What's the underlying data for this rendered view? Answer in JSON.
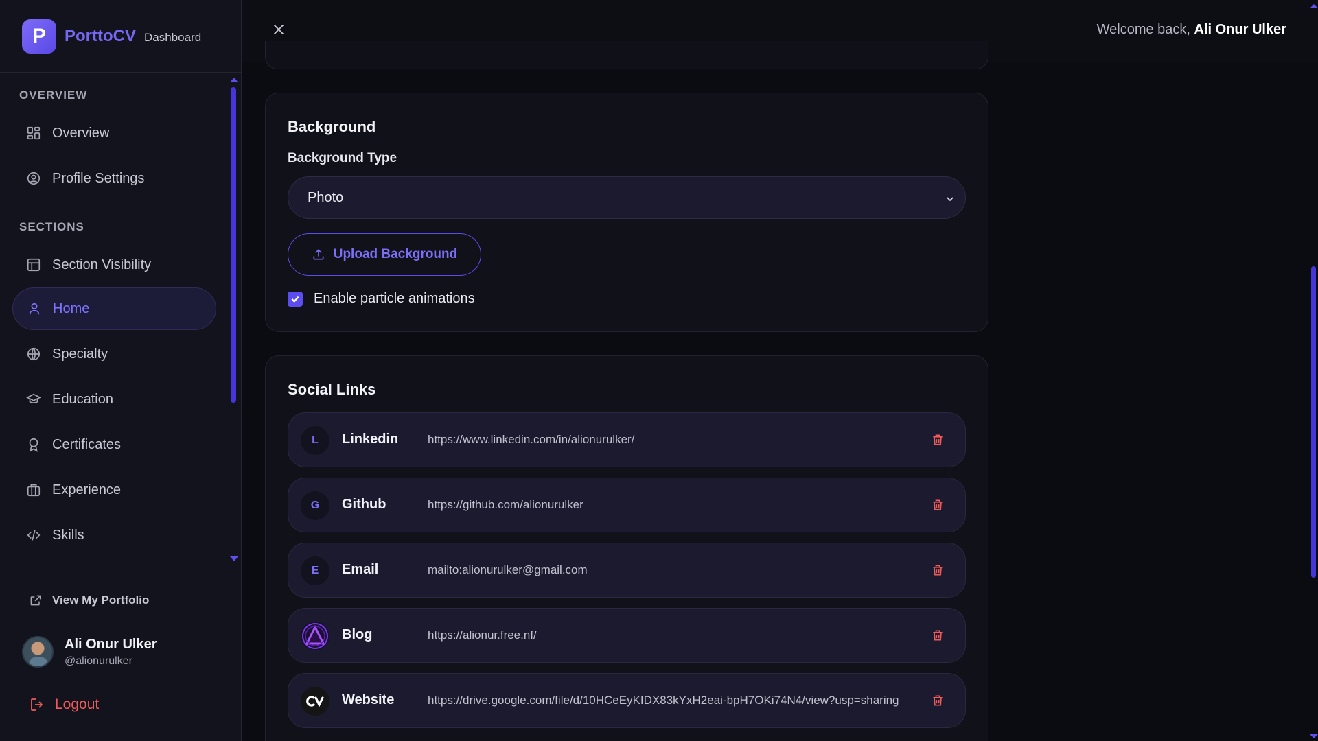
{
  "brand": {
    "logo_letter": "P",
    "name": "PorttoCV",
    "subtitle": "Dashboard"
  },
  "sidebar": {
    "groups": [
      {
        "title": "OVERVIEW"
      },
      {
        "title": "SECTIONS"
      }
    ],
    "items": [
      {
        "label": "Overview",
        "icon": "grid-icon"
      },
      {
        "label": "Profile Settings",
        "icon": "user-circle-icon"
      },
      {
        "label": "Section Visibility",
        "icon": "layout-icon"
      },
      {
        "label": "Home",
        "icon": "user-icon",
        "active": true
      },
      {
        "label": "Specialty",
        "icon": "globe-icon"
      },
      {
        "label": "Education",
        "icon": "graduation-cap-icon"
      },
      {
        "label": "Certificates",
        "icon": "award-icon"
      },
      {
        "label": "Experience",
        "icon": "briefcase-icon"
      },
      {
        "label": "Skills",
        "icon": "code-icon"
      }
    ],
    "view_portfolio": "View My Portfolio",
    "user": {
      "name": "Ali Onur Ulker",
      "handle": "@alionurulker"
    },
    "logout": "Logout"
  },
  "header": {
    "welcome_prefix": "Welcome back, ",
    "user_name": "Ali Onur Ulker"
  },
  "background": {
    "title": "Background",
    "type_label": "Background Type",
    "type_value": "Photo",
    "upload_label": "Upload Background",
    "particles_label": "Enable particle animations",
    "particles_checked": true
  },
  "social": {
    "title": "Social Links",
    "links": [
      {
        "letter": "L",
        "name": "Linkedin",
        "url": "https://www.linkedin.com/in/alionurulker/"
      },
      {
        "letter": "G",
        "name": "Github",
        "url": "https://github.com/alionurulker"
      },
      {
        "letter": "E",
        "name": "Email",
        "url": "mailto:alionurulker@gmail.com"
      },
      {
        "letter": "",
        "name": "Blog",
        "url": "https://alionur.free.nf/"
      },
      {
        "letter": "",
        "name": "Website",
        "url": "https://drive.google.com/file/d/10HCeEyKIDX83kYxH2eai-bpH7OKi74N4/view?usp=sharing"
      }
    ]
  },
  "colors": {
    "accent": "#5b4df0",
    "danger": "#ef5a5a",
    "surface": "#1c1a2e",
    "background": "#0b0b12"
  }
}
